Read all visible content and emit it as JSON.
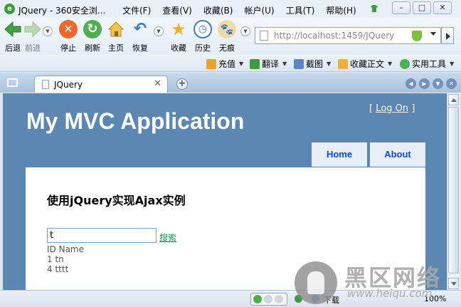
{
  "window": {
    "title": "JQuery - 360安全浏...",
    "menu": [
      "文件(F)",
      "查看(V)",
      "收藏(B)",
      "帐户(U)",
      "工具(T)",
      "帮助(H)"
    ]
  },
  "toolbar": {
    "back": "后退",
    "forward": "前进",
    "stop": "停止",
    "refresh": "刷新",
    "home": "主页",
    "restore": "恢复",
    "favorites": "收藏",
    "history": "历史",
    "incognito": "无痕"
  },
  "address": {
    "url": "http://localhost:1459/JQuery"
  },
  "favbar": {
    "items": [
      "充值",
      "翻译",
      "截图",
      "收藏正文",
      "实用工具"
    ]
  },
  "tabs": [
    {
      "label": "JQuery"
    }
  ],
  "site": {
    "title": "My MVC Application",
    "login_open": "[",
    "login_link": "Log On",
    "login_close": "]",
    "nav": [
      "Home",
      "About"
    ]
  },
  "main": {
    "heading": "使用jQuery实现Ajax实例",
    "search_value": "t",
    "search_link": "搜索",
    "results": [
      "ID Name",
      "1 tn",
      "4 tttt"
    ]
  },
  "statusbar": {
    "download": "下载",
    "zoom": "100%"
  },
  "watermark": {
    "text": "黑区网络",
    "url": "www.heiqu.com"
  },
  "colors": {
    "site_bg": "#5c87b2",
    "nav_text": "#034af3",
    "search_link": "#1a9e5c",
    "tabbar": "#aac3de"
  }
}
